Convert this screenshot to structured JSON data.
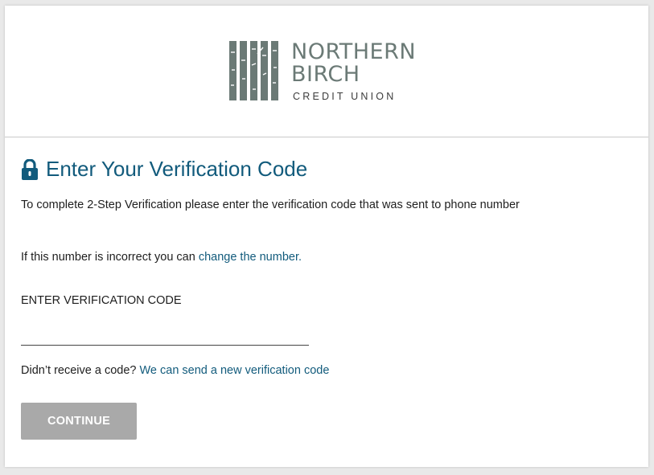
{
  "brand": {
    "line1": "NORTHERN",
    "line2": "BIRCH",
    "line3": "CREDIT UNION",
    "color": "#6b7a76"
  },
  "header": {
    "icon": "lock-icon",
    "title": "Enter Your Verification Code",
    "accent_color": "#125b7c"
  },
  "description": "To complete 2-Step Verification please enter the verification code that was sent to phone number",
  "incorrect": {
    "prefix": "If this number is incorrect you can ",
    "link": "change the number."
  },
  "code_field": {
    "label": "ENTER VERIFICATION CODE",
    "value": ""
  },
  "resend": {
    "prefix": "Didn’t receive a code? ",
    "link": "We can send a new verification code"
  },
  "continue_label": "CONTINUE",
  "button_color": "#a9a9a9"
}
